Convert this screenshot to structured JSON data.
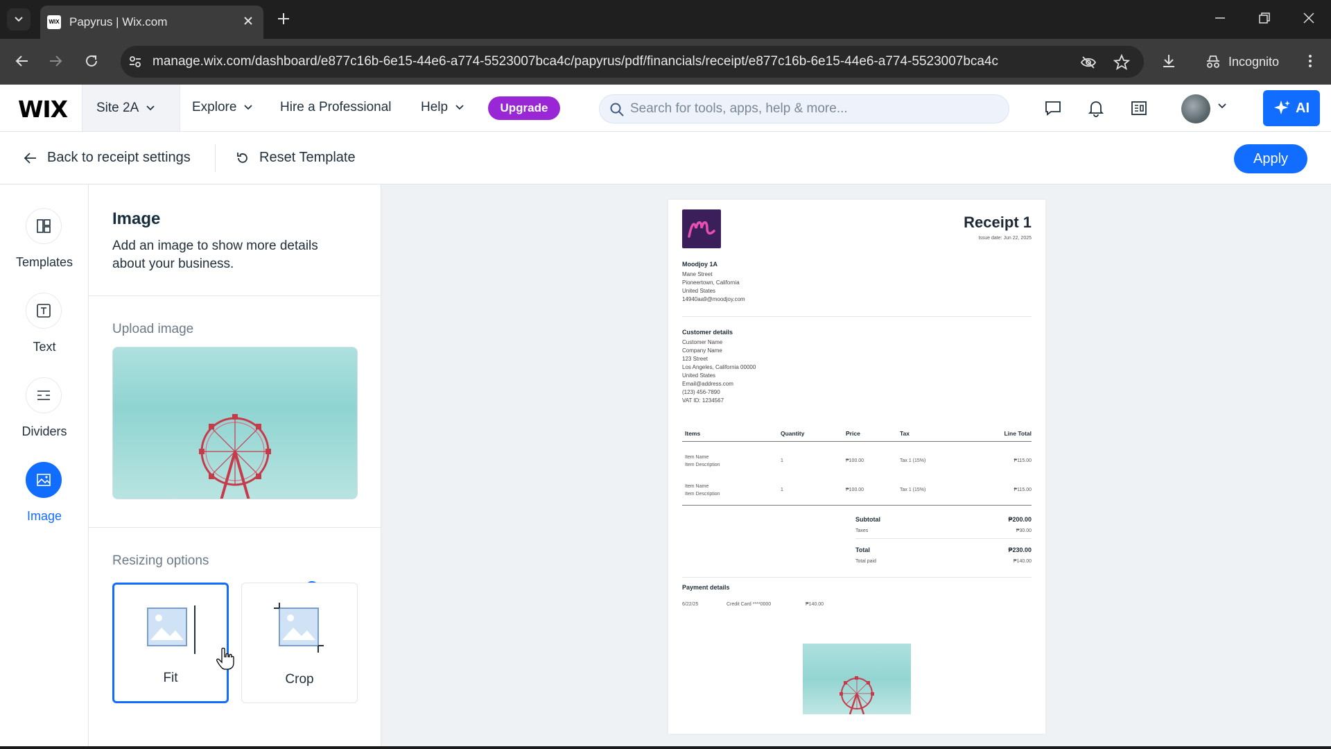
{
  "browser": {
    "tab_title": "Papyrus | Wix.com",
    "url": "manage.wix.com/dashboard/e877c16b-6e15-44e6-a774-5523007bca4c/papyrus/pdf/financials/receipt/e877c16b-6e15-44e6-a774-5523007bca4c",
    "incognito_label": "Incognito"
  },
  "wixbar": {
    "site_name": "Site 2A",
    "explore_label": "Explore",
    "hire_label": "Hire a Professional",
    "help_label": "Help",
    "upgrade_label": "Upgrade",
    "search_placeholder": "Search for tools, apps, help & more...",
    "ai_label": "AI"
  },
  "editor_header": {
    "back_label": "Back to receipt settings",
    "reset_label": "Reset Template",
    "apply_label": "Apply"
  },
  "rail": {
    "items": [
      {
        "label": "Templates",
        "icon": "templates-icon"
      },
      {
        "label": "Text",
        "icon": "text-icon"
      },
      {
        "label": "Dividers",
        "icon": "dividers-icon"
      },
      {
        "label": "Image",
        "icon": "image-icon",
        "active": true
      }
    ]
  },
  "panel": {
    "title": "Image",
    "description": "Add an image to show more details about your business.",
    "upload_label": "Upload image",
    "resizing_label": "Resizing options",
    "options": [
      {
        "label": "Fit",
        "selected": true
      },
      {
        "label": "Crop",
        "selected": false
      }
    ]
  },
  "receipt": {
    "title": "Receipt 1",
    "issue_date": "Issue date: Jun 22, 2025",
    "business": {
      "name": "Moodjoy 1A",
      "lines": [
        "Mane Street",
        "Pioneertown, California",
        "United States",
        "14940aa9@moodjoy.com"
      ]
    },
    "customer": {
      "heading": "Customer details",
      "lines": [
        "Customer Name",
        "Company Name",
        "123 Street",
        "Los Angeles, California 00000",
        "United States",
        "Email@address.com",
        "(123) 456-7890",
        "VAT ID: 1234567"
      ]
    },
    "table": {
      "headers": [
        "Items",
        "Quantity",
        "Price",
        "Tax",
        "Line Total"
      ],
      "rows": [
        {
          "name": "Item Name",
          "desc": "Item Description",
          "qty": "1",
          "price": "₱100.00",
          "tax": "Tax 1 (15%)",
          "total": "₱115.00"
        },
        {
          "name": "Item Name",
          "desc": "Item Description",
          "qty": "1",
          "price": "₱100.00",
          "tax": "Tax 1 (15%)",
          "total": "₱115.00"
        }
      ]
    },
    "totals": {
      "subtotal_label": "Subtotal",
      "subtotal": "₱200.00",
      "taxes_label": "Taxes",
      "taxes": "₱30.00",
      "total_label": "Total",
      "total": "₱230.00",
      "paid_label": "Total paid",
      "paid": "₱140.00"
    },
    "payment": {
      "heading": "Payment details",
      "date": "6/22/25",
      "method": "Credit Card ****0000",
      "amount": "₱140.00"
    }
  },
  "colors": {
    "accent": "#116dff",
    "upgrade": "#9a27d5",
    "logo_bg": "#3b1f5a",
    "logo_fg": "#e84fb0"
  }
}
